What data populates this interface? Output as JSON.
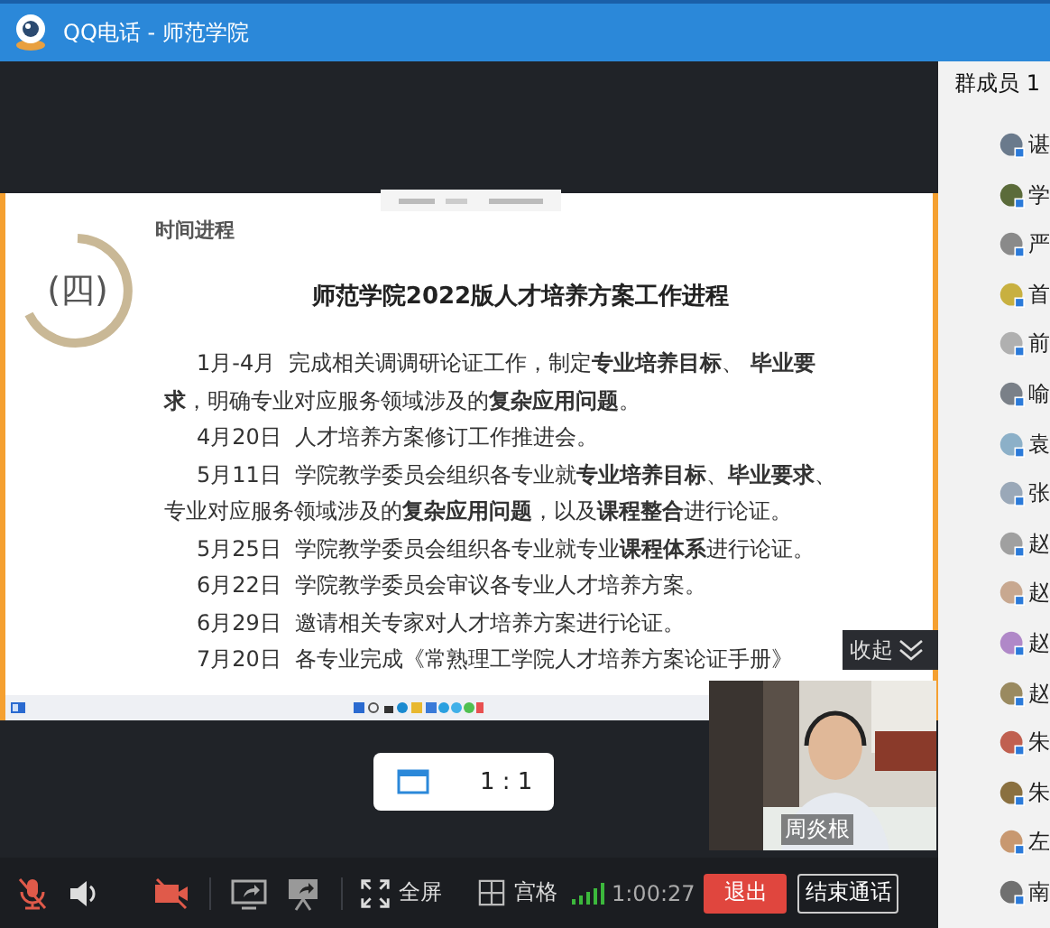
{
  "window": {
    "title": "QQ电话 - 师范学院"
  },
  "slide": {
    "section_label": "时间进程",
    "section_number": "(四)",
    "title": "师范学院2022版人才培养方案工作进程",
    "items": [
      {
        "text": "1月-4月  完成相关调调研论证工作，制定**专业培养目标**、 **毕业要求**，明确专业对应服务领域涉及的**复杂应用问题**。"
      },
      {
        "text": "4月20日  人才培养方案修订工作推进会。"
      },
      {
        "text": "5月11日  学院教学委员会组织各专业就**专业培养目标**、**毕业要求**、专业对应服务领域涉及的**复杂应用问题**，以及**课程整合**进行论证。"
      },
      {
        "text": "5月25日  学院教学委员会组织各专业就专业**课程体系**进行论证。"
      },
      {
        "text": "6月22日  学院教学委员会审议各专业人才培养方案。"
      },
      {
        "text": "6月29日  邀请相关专家对人才培养方案进行论证。"
      },
      {
        "text": "7月20日  各专业完成《常熟理工学院人才培养方案论证手册》"
      }
    ]
  },
  "collapse_button": "收起",
  "zoom_button": "1 : 1",
  "video": {
    "name": "周炎根"
  },
  "toolbar": {
    "mic_muted": true,
    "camera_off": true,
    "fullscreen": "全屏",
    "grid": "宫格",
    "duration": "1:00:27",
    "leave": "退出",
    "end_call": "结束通话"
  },
  "members": {
    "header": "群成员 1",
    "items": [
      {
        "name": "谌"
      },
      {
        "name": "学"
      },
      {
        "name": "严"
      },
      {
        "name": "首"
      },
      {
        "name": "前"
      },
      {
        "name": "喻"
      },
      {
        "name": "袁"
      },
      {
        "name": "张"
      },
      {
        "name": "赵"
      },
      {
        "name": "赵"
      },
      {
        "name": "赵"
      },
      {
        "name": "赵"
      },
      {
        "name": "朱"
      },
      {
        "name": "朱"
      },
      {
        "name": "左"
      },
      {
        "name": "南"
      }
    ]
  }
}
